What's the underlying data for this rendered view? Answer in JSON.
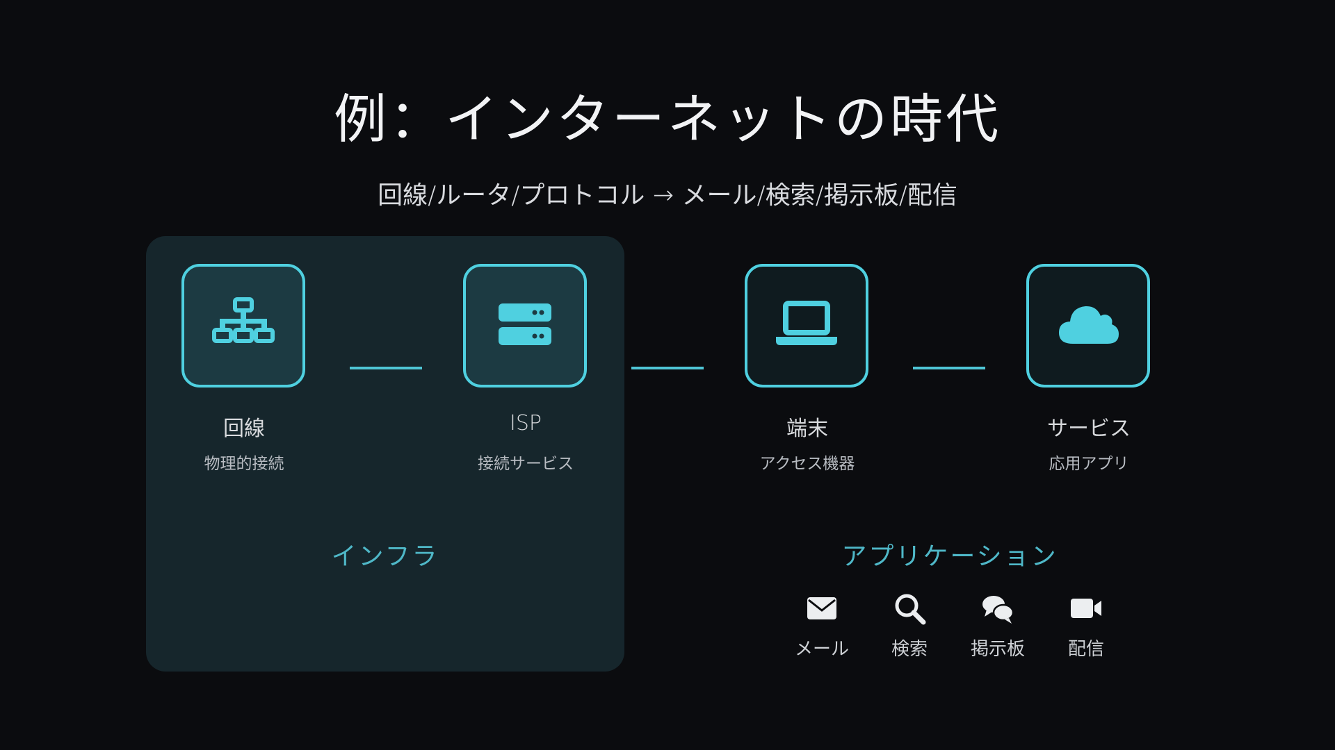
{
  "slide": {
    "title": "例：インターネットの時代",
    "subtitle": "回線/ルータ/プロトコル → メール/検索/掲示板/配信"
  },
  "colors": {
    "background": "#0b0c0f",
    "infra_panel": "#16262c",
    "accent": "#4fd0e0",
    "group_label": "#4fb8c8"
  },
  "nodes": [
    {
      "icon": "network-icon",
      "label": "回線",
      "sub": "物理的接続",
      "group": "infra"
    },
    {
      "icon": "server-icon",
      "label": "ISP",
      "sub": "接続サービス",
      "group": "infra"
    },
    {
      "icon": "laptop-icon",
      "label": "端末",
      "sub": "アクセス機器",
      "group": "app"
    },
    {
      "icon": "cloud-icon",
      "label": "サービス",
      "sub": "応用アプリ",
      "group": "app"
    }
  ],
  "groups": {
    "infra": "インフラ",
    "app": "アプリケーション"
  },
  "apps": [
    {
      "icon": "mail-icon",
      "label": "メール"
    },
    {
      "icon": "search-icon",
      "label": "検索"
    },
    {
      "icon": "chat-icon",
      "label": "掲示板"
    },
    {
      "icon": "video-icon",
      "label": "配信"
    }
  ]
}
